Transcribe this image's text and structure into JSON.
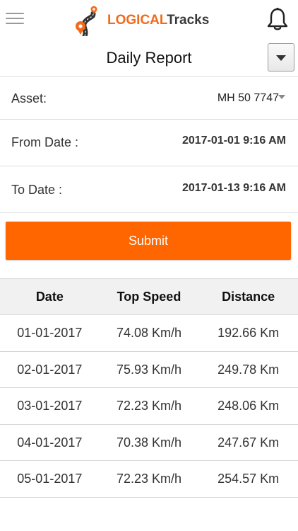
{
  "header": {
    "logo_text_part1": "LOGICAL",
    "logo_text_part2": "Tracks",
    "menu_icon": "hamburger-menu-icon",
    "notification_icon": "bell-icon"
  },
  "page": {
    "title": "Daily Report",
    "dropdown_icon": "triangle-down-icon"
  },
  "form": {
    "asset_label": "Asset:",
    "asset_value": "MH 50 7747",
    "from_label": "From Date :",
    "from_value": "2017-01-01 9:16 AM",
    "to_label": "To Date :",
    "to_value": "2017-01-13 9:16 AM",
    "submit_label": "Submit"
  },
  "table": {
    "headers": [
      "Date",
      "Top Speed",
      "Distance"
    ],
    "rows": [
      [
        "01-01-2017",
        "74.08 Km/h",
        "192.66 Km"
      ],
      [
        "02-01-2017",
        "75.93 Km/h",
        "249.78 Km"
      ],
      [
        "03-01-2017",
        "72.23 Km/h",
        "248.06 Km"
      ],
      [
        "04-01-2017",
        "70.38 Km/h",
        "247.67 Km"
      ],
      [
        "05-01-2017",
        "72.23 Km/h",
        "254.57 Km"
      ]
    ]
  },
  "colors": {
    "accent": "#ff6600",
    "logo_dark": "#3a3a3a",
    "divider": "#dcdcdc",
    "table_header_bg": "#f1f1f1"
  }
}
